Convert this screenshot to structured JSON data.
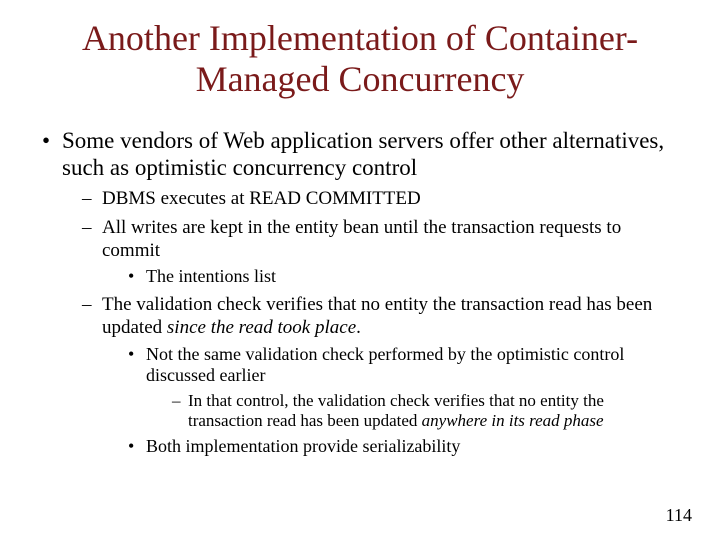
{
  "title": "Another Implementation of Container-Managed Concurrency",
  "bullet1": "Some vendors of Web application servers offer other alternatives, such as optimistic concurrency control",
  "sub1": "DBMS executes at READ COMMITTED",
  "sub2": "All writes are kept in the entity bean until the transaction requests to commit",
  "sub2a": "The intentions list",
  "sub3a": "The validation check verifies that no entity the transaction read has been updated ",
  "sub3b_italic": "since the read took place",
  "sub3c": ".",
  "sub3_1a": "Not the same validation check",
  "sub3_1b": " performed by the optimistic control discussed earlier",
  "sub3_1_1a": "In that control, the validation check verifies  that no entity the transaction read has been updated ",
  "sub3_1_1b_italic": "anywhere in its read phase",
  "sub3_2": "Both implementation provide serializability",
  "page_number": "114"
}
